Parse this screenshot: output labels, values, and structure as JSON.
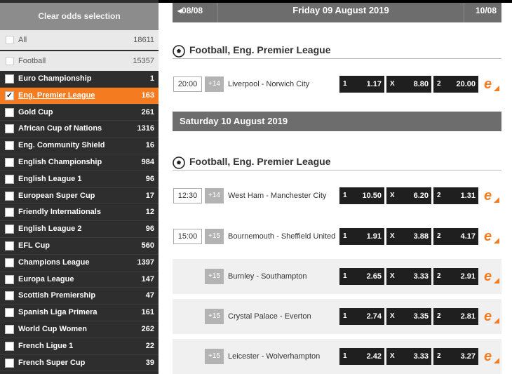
{
  "sidebar": {
    "clear_label": "Clear odds selection",
    "all": {
      "label": "All",
      "count": "18611"
    },
    "sport": {
      "label": "Football",
      "count": "15357"
    },
    "leagues": [
      {
        "label": "Euro Championship",
        "count": "1",
        "checked": false
      },
      {
        "label": "Eng. Premier League",
        "count": "163",
        "checked": true
      },
      {
        "label": "Gold Cup",
        "count": "261",
        "checked": false
      },
      {
        "label": "African Cup of Nations",
        "count": "1316",
        "checked": false
      },
      {
        "label": "Eng. Community Shield",
        "count": "16",
        "checked": false
      },
      {
        "label": "English Championship",
        "count": "984",
        "checked": false
      },
      {
        "label": "English League 1",
        "count": "96",
        "checked": false
      },
      {
        "label": "European Super Cup",
        "count": "17",
        "checked": false
      },
      {
        "label": "Friendly Internationals",
        "count": "12",
        "checked": false
      },
      {
        "label": "English League 2",
        "count": "96",
        "checked": false
      },
      {
        "label": "EFL Cup",
        "count": "560",
        "checked": false
      },
      {
        "label": "Champions League",
        "count": "1397",
        "checked": false
      },
      {
        "label": "Europa League",
        "count": "147",
        "checked": false
      },
      {
        "label": "Scottish Premiership",
        "count": "47",
        "checked": false
      },
      {
        "label": "Spanish Liga Primera",
        "count": "161",
        "checked": false
      },
      {
        "label": "World Cup Women",
        "count": "262",
        "checked": false
      },
      {
        "label": "French Ligue 1",
        "count": "22",
        "checked": false
      },
      {
        "label": "French Super Cup",
        "count": "39",
        "checked": false
      }
    ]
  },
  "date_nav": {
    "prev": "08/08",
    "title": "Friday 09 August 2019",
    "next": "10/08"
  },
  "sections": [
    {
      "league": "Football, Eng. Premier League"
    },
    {
      "day": "Saturday 10 August 2019",
      "league": "Football, Eng. Premier League"
    }
  ],
  "odds_keys": {
    "home": "1",
    "draw": "X",
    "away": "2"
  },
  "matches": [
    {
      "time": "20:00",
      "more": "+14",
      "teams": "Liverpool - Norwich City",
      "home": "1.17",
      "draw": "8.80",
      "away": "20.00"
    },
    {
      "time": "12:30",
      "more": "+14",
      "teams": "West Ham - Manchester City",
      "home": "10.50",
      "draw": "6.20",
      "away": "1.31"
    },
    {
      "time": "15:00",
      "more": "+15",
      "teams": "Bournemouth - Sheffield United",
      "home": "1.91",
      "draw": "3.88",
      "away": "4.17"
    },
    {
      "time": "",
      "more": "+15",
      "teams": "Burnley - Southampton",
      "home": "2.65",
      "draw": "3.33",
      "away": "2.91"
    },
    {
      "time": "",
      "more": "+15",
      "teams": "Crystal Palace - Everton",
      "home": "2.74",
      "draw": "3.35",
      "away": "2.81"
    },
    {
      "time": "",
      "more": "+15",
      "teams": "Leicester - Wolverhampton",
      "home": "2.42",
      "draw": "3.33",
      "away": "3.27"
    }
  ],
  "colors": {
    "accent": "#f47b20",
    "sidebar_bg": "#2e2e2e",
    "band_bg": "#6d6d6d",
    "odds_bg": "#1f1f1f"
  },
  "icons": {
    "prev": "triangle-left-icon",
    "next": "triangle-right-icon",
    "sport": "soccer-ball-icon",
    "bet": "e-logo-icon"
  }
}
